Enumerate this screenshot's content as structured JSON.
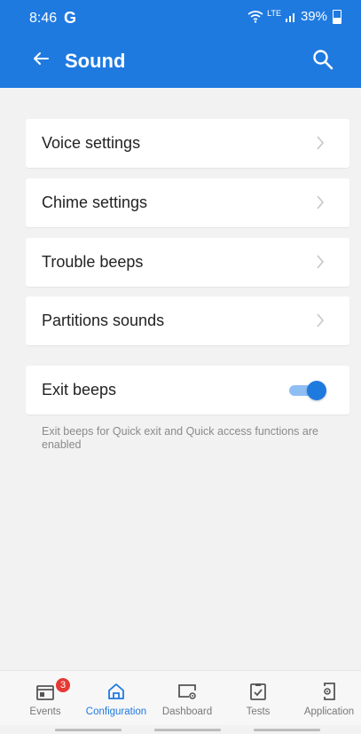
{
  "status_bar": {
    "time": "8:46",
    "google_glyph": "G",
    "network": "LTE",
    "battery": "39%"
  },
  "header": {
    "title": "Sound",
    "back_icon": "arrow-left-icon",
    "search_icon": "search-icon"
  },
  "menu": {
    "voice_settings": "Voice settings",
    "chime_settings": "Chime settings",
    "trouble_beeps": "Trouble beeps",
    "partitions_sounds": "Partitions sounds"
  },
  "exit_beeps": {
    "label": "Exit beeps",
    "enabled": true,
    "hint": "Exit beeps for Quick exit and Quick access functions are enabled"
  },
  "bottom_nav": {
    "events": {
      "label": "Events",
      "badge": "3"
    },
    "configuration": {
      "label": "Configuration"
    },
    "dashboard": {
      "label": "Dashboard"
    },
    "tests": {
      "label": "Tests"
    },
    "application": {
      "label": "Application"
    }
  },
  "colors": {
    "primary": "#1f7ae0",
    "badge": "#e53935",
    "background": "#f2f2f2"
  }
}
